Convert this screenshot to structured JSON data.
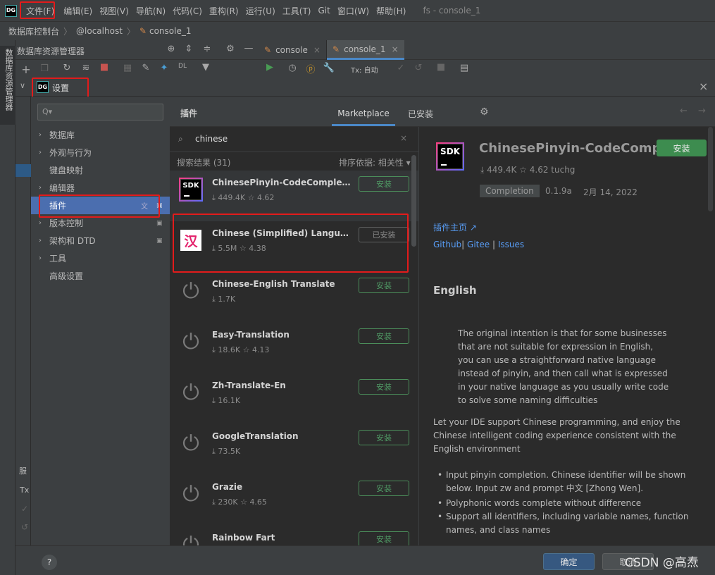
{
  "menu": {
    "items": [
      "文件(F)",
      "编辑(E)",
      "视图(V)",
      "导航(N)",
      "代码(C)",
      "重构(R)",
      "运行(U)",
      "工具(T)",
      "Git",
      "窗口(W)",
      "帮助(H)"
    ],
    "project": "fs - console_1"
  },
  "breadcrumb": {
    "a": "数据库控制台",
    "b": "@localhost",
    "c": "console_1"
  },
  "toolwindow": {
    "title": "数据库资源管理器",
    "side_label": "数据库资源管理器",
    "tab1": "console",
    "tab2": "console_1",
    "tx_label": "Tx: 自动"
  },
  "settings": {
    "title": "设置",
    "search_placeholder": "Q▾",
    "nav": [
      "数据库",
      "外观与行为",
      "键盘映射",
      "编辑器",
      "插件",
      "版本控制",
      "架构和 DTD",
      "工具",
      "高级设置"
    ],
    "plugins_title": "插件",
    "tab_marketplace": "Marketplace",
    "tab_installed": "已安装"
  },
  "plugin_list": {
    "search_value": "chinese",
    "results_label": "搜索结果 (31)",
    "sort_label": "排序依据: 相关性 ▾",
    "items": [
      {
        "name": "ChinesePinyin-CodeCompletio...",
        "downloads": "449.4K",
        "rating": "4.62",
        "button": "安装",
        "icon": "sdk-icon"
      },
      {
        "name": "Chinese (Simplified) Languag...",
        "downloads": "5.5M",
        "rating": "4.38",
        "button": "已安装",
        "icon": "han-icon"
      },
      {
        "name": "Chinese-English Translate",
        "downloads": "1.7K",
        "rating": "",
        "button": "安装",
        "icon": "plug-icon"
      },
      {
        "name": "Easy-Translation",
        "downloads": "18.6K",
        "rating": "4.13",
        "button": "安装",
        "icon": "plug-icon"
      },
      {
        "name": "Zh-Translate-En",
        "downloads": "16.1K",
        "rating": "",
        "button": "安装",
        "icon": "plug-icon"
      },
      {
        "name": "GoogleTranslation",
        "downloads": "73.5K",
        "rating": "",
        "button": "安装",
        "icon": "plug-icon"
      },
      {
        "name": "Grazie",
        "downloads": "230K",
        "rating": "4.65",
        "button": "安装",
        "icon": "plug-icon"
      },
      {
        "name": "Rainbow Fart",
        "downloads": "",
        "rating": "",
        "button": "安装",
        "icon": "plug-icon"
      }
    ]
  },
  "detail": {
    "name": "ChinesePinyin-CodeCompl",
    "install": "安装",
    "downloads": "449.4K",
    "rating": "4.62",
    "author": "tuchg",
    "tag": "Completion",
    "version": "0.1.9a",
    "date": "2月 14, 2022",
    "homepage": "插件主页 ↗",
    "link_github": "Github",
    "link_gitee": "Gitee",
    "link_issues": "Issues",
    "heading": "English",
    "para1": "The original intention is that for some businesses that are not suitable for expression in English, you can use a straightforward native language instead of pinyin, and then call what is expressed in your native language as you usually write code to solve some naming difficulties",
    "para2": "Let your IDE support Chinese programming, and enjoy the Chinese intelligent coding experience consistent with the English environment",
    "bullets": [
      "Input pinyin completion. Chinese identifier will be shown below. Input zw and prompt 中文 [Zhong Wen].",
      "Polyphonic words complete without difference",
      "Support all identifiers, including variable names, function names, and class names"
    ]
  },
  "footer": {
    "ok": "确定",
    "cancel": "取消",
    "help": "?",
    "watermark": "CSDN @高焘"
  },
  "side_fragments": {
    "a": "服",
    "b": "Tx"
  },
  "colors": {
    "selection": "#4b6eaf",
    "install_green": "#4f9964",
    "link": "#589df6",
    "annotation_red": "#e21b1b"
  }
}
